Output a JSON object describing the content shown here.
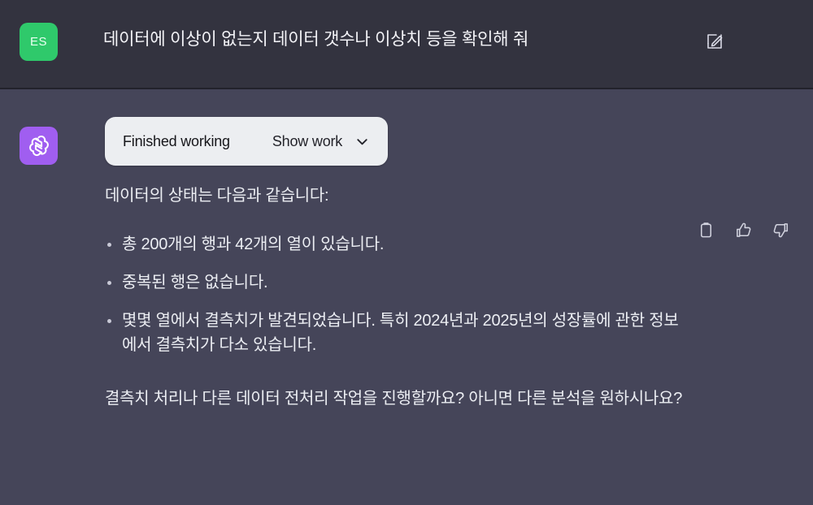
{
  "colors": {
    "user_band_bg": "#33333f",
    "body_bg": "#454559",
    "user_avatar_bg": "#2fc96b",
    "assistant_avatar_bg": "#a05ef0",
    "card_bg": "#eceef1",
    "text_primary": "#eceef3"
  },
  "user_turn": {
    "avatar_initials": "ES",
    "message": "데이터에 이상이 없는지 데이터 갯수나 이상치 등을 확인해 줘",
    "edit_icon": "edit-pencil-icon"
  },
  "assistant_turn": {
    "avatar_icon": "openai-logo-icon",
    "work_card": {
      "title": "Finished working",
      "show_work_label": "Show work",
      "chevron_icon": "chevron-down-icon"
    },
    "lead": "데이터의 상태는 다음과 같습니다:",
    "bullets": [
      "총 200개의 행과 42개의 열이 있습니다.",
      "중복된 행은 없습니다.",
      "몇몇 열에서 결측치가 발견되었습니다. 특히 2024년과 2025년의 성장률에 관한 정보에서 결측치가 다소 있습니다."
    ],
    "closing": "결측치 처리나 다른 데이터 전처리 작업을 진행할까요? 아니면 다른 분석을 원하시나요?",
    "actions": [
      {
        "name": "copy-icon",
        "label": "Copy"
      },
      {
        "name": "thumbs-up-icon",
        "label": "Good response"
      },
      {
        "name": "thumbs-down-icon",
        "label": "Bad response"
      }
    ]
  }
}
